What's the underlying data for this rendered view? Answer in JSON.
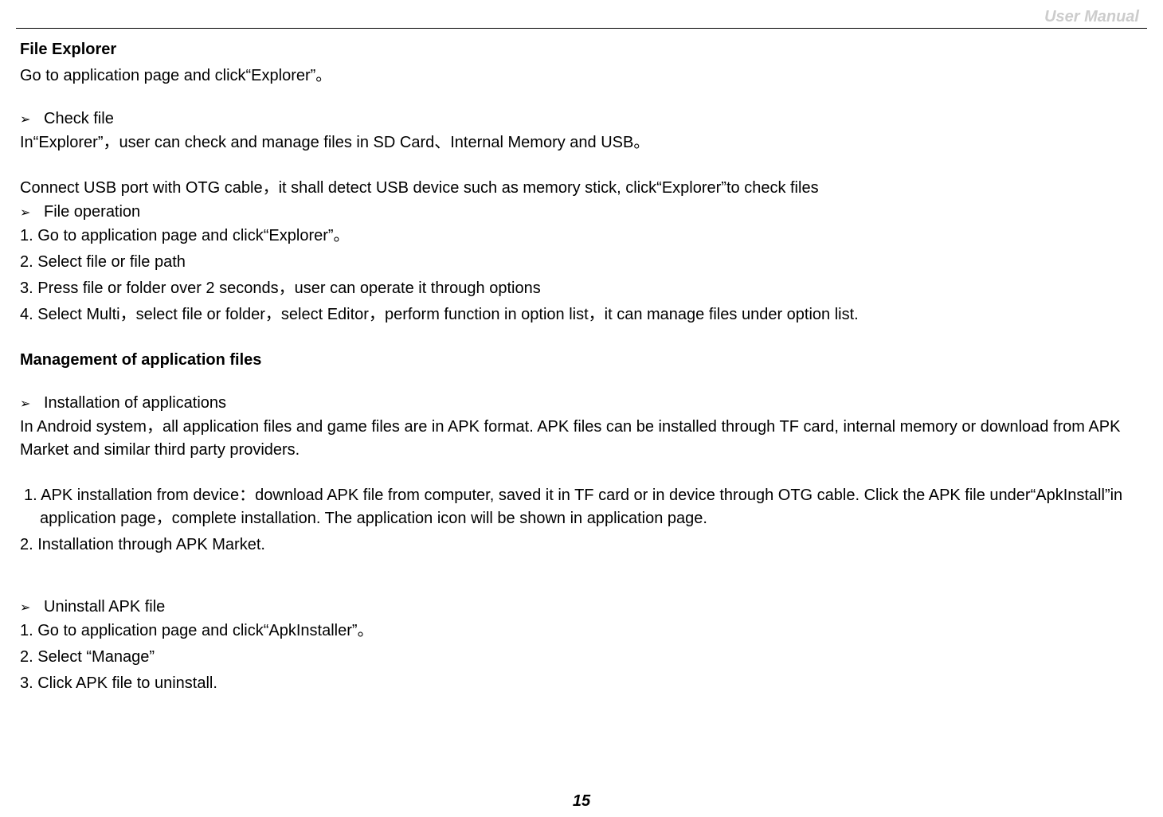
{
  "header": {
    "right": "User Manual"
  },
  "section1": {
    "title": "File Explorer",
    "intro": "Go to application page and click“Explorer”。",
    "bullet1": "Check file",
    "desc1": "In“Explorer”，user can check and manage files in SD Card、Internal Memory and USB。",
    "desc2": "Connect USB port with OTG cable，it shall detect USB device such as memory stick, click“Explorer”to check files",
    "bullet2": "File operation",
    "step1": "1. Go to application page and click“Explorer”。",
    "step2": "2. Select file or file path",
    "step3": "3. Press file or folder over 2 seconds，user can operate it through options",
    "step4": "4. Select Multi，select file or folder，select Editor，perform function in option list，it can manage files under option list."
  },
  "section2": {
    "title": "Management of application files",
    "bullet1": "Installation of applications",
    "desc1": "In Android system，all application files and game files are in APK format. APK files can be installed through TF card, internal memory or download from APK Market and similar third party providers.",
    "step1": "1. APK installation from device：download APK file from computer, saved it in TF card or in device through OTG cable. Click the APK file under“ApkInstall”in application page，complete installation. The application icon will be shown in application page.",
    "step2": "2. Installation through APK Market.",
    "bullet2": "Uninstall APK file",
    "ustep1": "1. Go to application page and click“ApkInstaller”。",
    "ustep2": "2. Select “Manage”",
    "ustep3": "3. Click APK file to uninstall."
  },
  "page_number": "15"
}
